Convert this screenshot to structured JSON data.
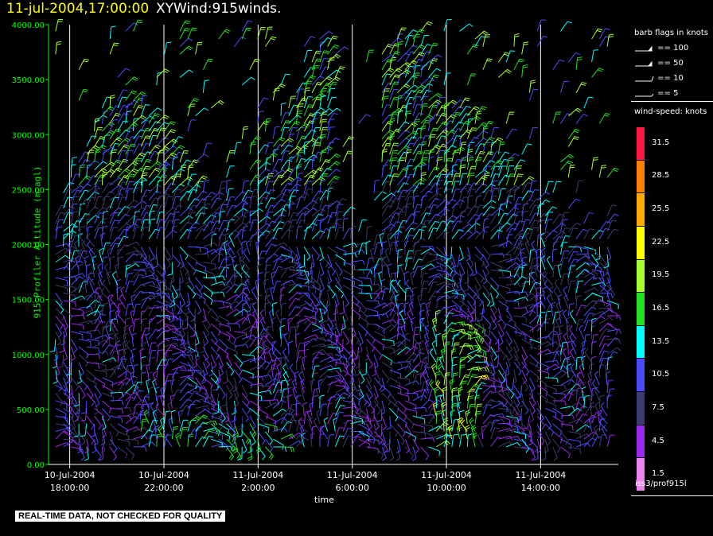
{
  "header": {
    "datetime": "11-jul-2004,17:00:00",
    "product": "XYWind:915winds."
  },
  "chart_data": {
    "type": "wind-barb time-height",
    "ylabel": "915 Profiler Altitude (m agl)",
    "xlabel": "time",
    "ylim": [
      0,
      4000
    ],
    "y_ticks": [
      "0.00",
      "500.00",
      "1000.00",
      "1500.00",
      "2000.00",
      "2500.00",
      "3000.00",
      "3500.00",
      "4000.00"
    ],
    "x_ticks": [
      {
        "date": "10-Jul-2004",
        "time": "18:00:00",
        "hours": 0
      },
      {
        "date": "10-Jul-2004",
        "time": "22:00:00",
        "hours": 4
      },
      {
        "date": "11-Jul-2004",
        "time": "2:00:00",
        "hours": 8
      },
      {
        "date": "11-Jul-2004",
        "time": "6:00:00",
        "hours": 12
      },
      {
        "date": "11-Jul-2004",
        "time": "10:00:00",
        "hours": 16
      },
      {
        "date": "11-Jul-2004",
        "time": "14:00:00",
        "hours": 20
      }
    ],
    "x_range_hours": [
      -0.9,
      23.3
    ],
    "grid": "vertical lines at tick times",
    "barb_flags": [
      {
        "label": "== 100"
      },
      {
        "label": "== 50"
      },
      {
        "label": "== 10"
      },
      {
        "label": "== 5"
      }
    ],
    "color_scale": [
      {
        "value": "31.5",
        "color": "#ff1744"
      },
      {
        "value": "28.5",
        "color": "#ff7f00"
      },
      {
        "value": "25.5",
        "color": "#ffaa00"
      },
      {
        "value": "22.5",
        "color": "#ffff00"
      },
      {
        "value": "19.5",
        "color": "#a8ff2e"
      },
      {
        "value": "16.5",
        "color": "#22e022"
      },
      {
        "value": "13.5",
        "color": "#00ffff"
      },
      {
        "value": "10.5",
        "color": "#4c4cff"
      },
      {
        "value": "7.5",
        "color": "#3c3c70"
      },
      {
        "value": "4.5",
        "color": "#9a28f0"
      },
      {
        "value": "1.5",
        "color": "#ee82ee"
      }
    ]
  },
  "legend": {
    "flags_title": "barb flags in knots",
    "speed_title": "wind-speed: knots"
  },
  "source": "iss3/prof915l",
  "banner": "REAL-TIME DATA, NOT CHECKED FOR QUALITY"
}
